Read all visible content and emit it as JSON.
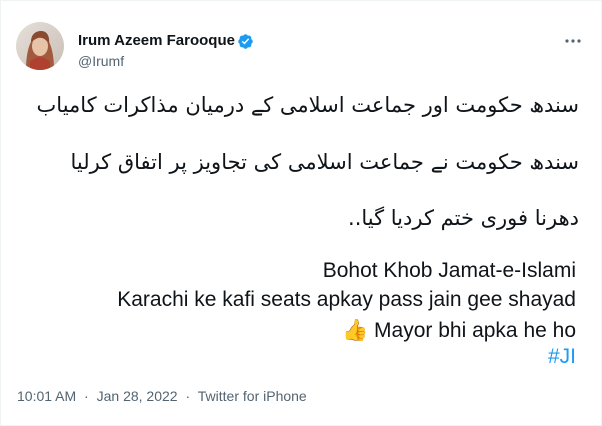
{
  "author": {
    "display_name": "Irum Azeem Farooque",
    "handle": "@Irumf",
    "verified_icon": "verified-badge-icon",
    "verified_color": "#1d9bf0"
  },
  "menu": {
    "icon": "more-horizontal-icon"
  },
  "tweet": {
    "urdu_lines": [
      "سندھ حکومت اور جماعت اسلامی کے درمیان مذاکرات کامیاب",
      "سندھ حکومت نے جماعت اسلامی کی تجاویز پر اتفاق کرلیا",
      "دھرنا فوری ختم کردیا گیا.."
    ],
    "english_lines": [
      "Bohot Khob Jamat-e-Islami",
      "Karachi ke kafi seats apkay pass jain gee shayad",
      "Mayor bhi apka he ho"
    ],
    "emoji": "👍",
    "hashtag": "#JI",
    "hashtag_color": "#1d9bf0"
  },
  "meta": {
    "time": "10:01 AM",
    "separator": "·",
    "date": "Jan 28, 2022",
    "source": "Twitter for iPhone"
  }
}
